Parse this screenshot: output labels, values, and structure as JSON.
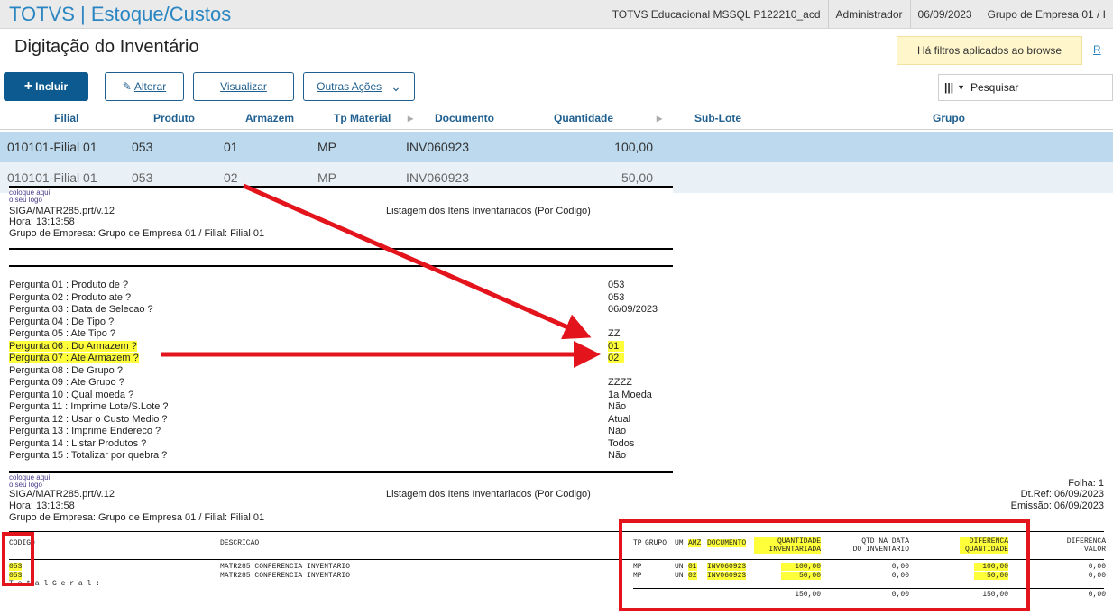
{
  "topbar": {
    "app_title": "TOTVS | Estoque/Custos",
    "environment": "TOTVS Educacional MSSQL P122210_acd",
    "user": "Administrador",
    "date": "06/09/2023",
    "company": "Grupo de Empresa 01 / I"
  },
  "page": {
    "title": "Digitação do Inventário",
    "filter_notice": "Há filtros aplicados ao browse",
    "filter_link": "R"
  },
  "toolbar": {
    "include": "Incluir",
    "alter": "Alterar",
    "view": "Visualizar",
    "other": "Outras Ações",
    "search_placeholder": "Pesquisar"
  },
  "grid": {
    "headers": [
      "Filial",
      "Produto",
      "Armazem",
      "Tp Material",
      "Documento",
      "Quantidade",
      "Sub-Lote",
      "Grupo"
    ],
    "rows": [
      [
        "010101-Filial 01",
        "053",
        "01",
        "MP",
        "INV060923",
        "100,00"
      ],
      [
        "010101-Filial 01",
        "053",
        "02",
        "MP",
        "INV060923",
        "50,00"
      ]
    ]
  },
  "report1": {
    "logo_line1": "coloque aqui",
    "logo_line2": "o seu logo",
    "program": "SIGA/MATR285.prt/v.12",
    "time": "Hora: 13:13:58",
    "group": "Grupo de Empresa: Grupo de Empresa 01 / Filial: Filial 01",
    "title": "Listagem dos Itens Inventariados (Por Codigo)",
    "questions": [
      {
        "q": "Pergunta 01 : Produto de ?",
        "a": "053"
      },
      {
        "q": "Pergunta 02 : Produto ate ?",
        "a": "053"
      },
      {
        "q": "Pergunta 03 : Data de Selecao ?",
        "a": "06/09/2023"
      },
      {
        "q": "Pergunta 04 : De  Tipo ?",
        "a": ""
      },
      {
        "q": "Pergunta 05 : Ate Tipo ?",
        "a": "ZZ"
      },
      {
        "q": "Pergunta 06 : Do Armazem ?",
        "a": "01"
      },
      {
        "q": "Pergunta 07 : Ate Armazem ?",
        "a": "02"
      },
      {
        "q": "Pergunta 08 : De  Grupo ?",
        "a": ""
      },
      {
        "q": "Pergunta 09 : Ate Grupo ?",
        "a": "ZZZZ"
      },
      {
        "q": "Pergunta 10 : Qual moeda ?",
        "a": "1a Moeda"
      },
      {
        "q": "Pergunta 11 : Imprime Lote/S.Lote ?",
        "a": "Não"
      },
      {
        "q": "Pergunta 12 : Usar o Custo Medio ?",
        "a": "Atual"
      },
      {
        "q": "Pergunta 13 : Imprime Endereco ?",
        "a": "Não"
      },
      {
        "q": "Pergunta 14 : Listar Produtos ?",
        "a": "Todos"
      },
      {
        "q": "Pergunta 15 : Totalizar por quebra ?",
        "a": "Não"
      }
    ]
  },
  "report2": {
    "folha": "Folha:   1",
    "dtref": "Dt.Ref: 06/09/2023",
    "emissao": "Emissão: 06/09/2023",
    "col_codigo": "CODIGO",
    "col_descricao": "DESCRICAO",
    "col_tp": "TP",
    "col_grupo": "GRUPO",
    "col_um": "UM",
    "col_amz": "AMZ",
    "col_documento": "DOCUMENTO",
    "col_qtd_inv_1": "QUANTIDADE",
    "col_qtd_inv_2": "INVENTARIADA",
    "col_qtd_data_1": "QTD NA DATA",
    "col_qtd_data_2": "DO INVENTARIO",
    "col_dif_qtd_1": "DIFERENCA",
    "col_dif_qtd_2": "QUANTIDADE",
    "col_dif_val_1": "DIFERENCA",
    "col_dif_val_2": "VALOR",
    "lines": [
      {
        "codigo": "053",
        "descricao": "MATR285 CONFERENCIA INVENTARIO",
        "tp": "MP",
        "um": "UN",
        "amz": "01",
        "doc": "INV060923",
        "qtd": "100,00",
        "qtd_data": "0,00",
        "dif_qtd": "100,00",
        "dif_val": "0,00"
      },
      {
        "codigo": "053",
        "descricao": "MATR285 CONFERENCIA INVENTARIO",
        "tp": "MP",
        "um": "UN",
        "amz": "02",
        "doc": "INV060923",
        "qtd": "50,00",
        "qtd_data": "0,00",
        "dif_qtd": "50,00",
        "dif_val": "0,00"
      }
    ],
    "total_label": "T o t a l  G e r a l :",
    "totals": {
      "qtd": "150,00",
      "qtd_data": "0,00",
      "dif_qtd": "150,00",
      "dif_val": "0,00"
    }
  }
}
